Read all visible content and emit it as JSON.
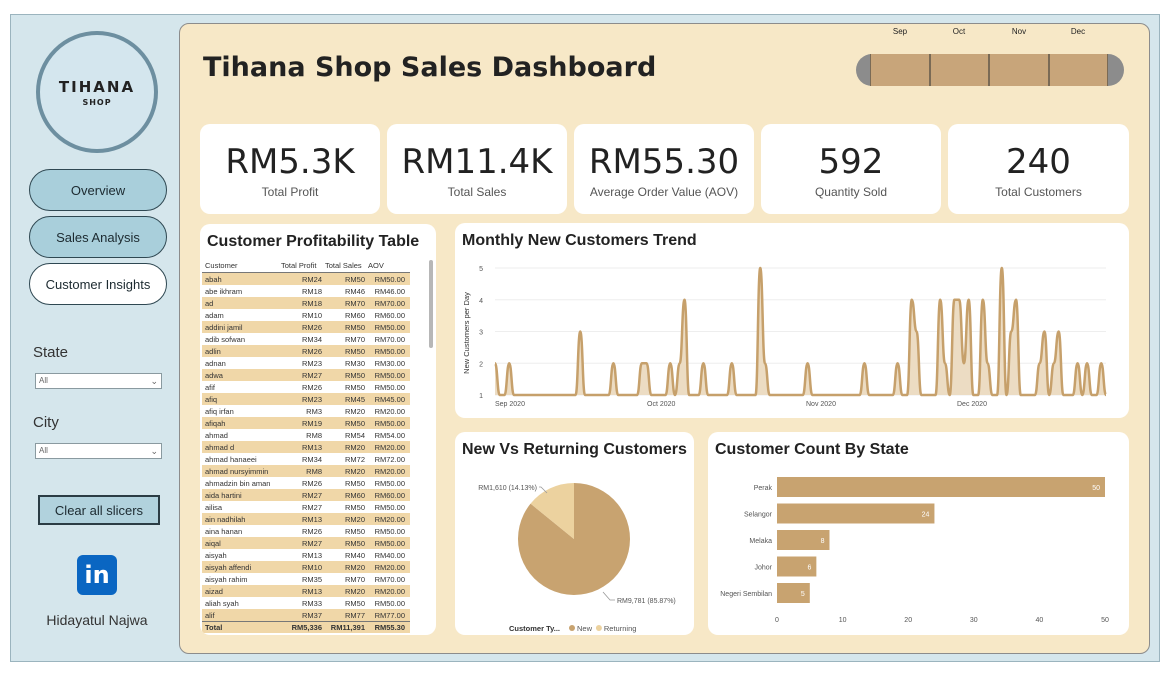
{
  "brand": {
    "name_line1": "TIHANA",
    "name_line2": "SHOP"
  },
  "nav": [
    {
      "label": "Overview"
    },
    {
      "label": "Sales Analysis"
    },
    {
      "label": "Customer Insights"
    }
  ],
  "filters": {
    "state": {
      "title": "State",
      "value": "All"
    },
    "city": {
      "title": "City",
      "value": "All"
    },
    "clear_label": "Clear all slicers"
  },
  "author": "Hidayatul Najwa",
  "linkedin_glyph": "in",
  "dashboard_title": "Tihana Shop Sales Dashboard",
  "timeline_months": [
    "Sep",
    "Oct",
    "Nov",
    "Dec"
  ],
  "kpis": [
    {
      "value": "RM5.3K",
      "label": "Total Profit"
    },
    {
      "value": "RM11.4K",
      "label": "Total Sales"
    },
    {
      "value": "RM55.30",
      "label": "Average Order Value (AOV)"
    },
    {
      "value": "592",
      "label": "Quantity Sold"
    },
    {
      "value": "240",
      "label": "Total Customers"
    }
  ],
  "table": {
    "title": "Customer Profitability Table",
    "columns": [
      "Customer",
      "Total Profit",
      "Total Sales",
      "AOV"
    ],
    "rows": [
      [
        "abah",
        "RM24",
        "RM50",
        "RM50.00"
      ],
      [
        "abe ikhram",
        "RM18",
        "RM46",
        "RM46.00"
      ],
      [
        "ad",
        "RM18",
        "RM70",
        "RM70.00"
      ],
      [
        "adam",
        "RM10",
        "RM60",
        "RM60.00"
      ],
      [
        "addini jamil",
        "RM26",
        "RM50",
        "RM50.00"
      ],
      [
        "adib sofwan",
        "RM34",
        "RM70",
        "RM70.00"
      ],
      [
        "adlin",
        "RM26",
        "RM50",
        "RM50.00"
      ],
      [
        "adnan",
        "RM23",
        "RM30",
        "RM30.00"
      ],
      [
        "adwa",
        "RM27",
        "RM50",
        "RM50.00"
      ],
      [
        "afif",
        "RM26",
        "RM50",
        "RM50.00"
      ],
      [
        "afiq",
        "RM23",
        "RM45",
        "RM45.00"
      ],
      [
        "afiq irfan",
        "RM3",
        "RM20",
        "RM20.00"
      ],
      [
        "afiqah",
        "RM19",
        "RM50",
        "RM50.00"
      ],
      [
        "ahmad",
        "RM8",
        "RM54",
        "RM54.00"
      ],
      [
        "ahmad d",
        "RM13",
        "RM20",
        "RM20.00"
      ],
      [
        "ahmad hanaeei",
        "RM34",
        "RM72",
        "RM72.00"
      ],
      [
        "ahmad nursyimmin",
        "RM8",
        "RM20",
        "RM20.00"
      ],
      [
        "ahmadzin bin aman",
        "RM26",
        "RM50",
        "RM50.00"
      ],
      [
        "aida hartini",
        "RM27",
        "RM60",
        "RM60.00"
      ],
      [
        "ailisa",
        "RM27",
        "RM50",
        "RM50.00"
      ],
      [
        "ain nadhilah",
        "RM13",
        "RM20",
        "RM20.00"
      ],
      [
        "aina hanan",
        "RM26",
        "RM50",
        "RM50.00"
      ],
      [
        "aiqal",
        "RM27",
        "RM50",
        "RM50.00"
      ],
      [
        "aisyah",
        "RM13",
        "RM40",
        "RM40.00"
      ],
      [
        "aisyah affendi",
        "RM10",
        "RM20",
        "RM20.00"
      ],
      [
        "aisyah rahim",
        "RM35",
        "RM70",
        "RM70.00"
      ],
      [
        "aizad",
        "RM13",
        "RM20",
        "RM20.00"
      ],
      [
        "aliah syah",
        "RM33",
        "RM50",
        "RM50.00"
      ],
      [
        "alif",
        "RM37",
        "RM77",
        "RM77.00"
      ]
    ],
    "total": [
      "Total",
      "RM5,336",
      "RM11,391",
      "RM55.30"
    ]
  },
  "chart_data": [
    {
      "type": "area",
      "title": "Monthly New Customers Trend",
      "ylabel": "New Customers per Day",
      "xlabel": "",
      "ylim": [
        1,
        5
      ],
      "yticks": [
        1,
        2,
        3,
        4,
        5
      ],
      "x_tick_labels": [
        "Sep 2020",
        "Oct 2020",
        "Nov 2020",
        "Dec 2020"
      ],
      "series": [
        {
          "values": [
            2,
            1,
            1,
            2,
            1,
            1,
            1,
            1,
            1,
            1,
            1,
            1,
            1,
            1,
            1,
            1,
            1,
            1,
            3,
            1,
            1,
            1,
            1,
            1,
            1,
            2,
            1,
            1,
            1,
            1,
            1,
            2,
            2,
            1,
            1,
            1,
            1,
            2,
            1,
            2,
            4,
            1,
            1,
            1,
            2,
            1,
            1,
            1,
            1,
            1,
            2,
            1,
            1,
            1,
            1,
            1,
            5,
            2,
            1,
            1,
            1,
            1,
            1,
            1,
            1,
            1,
            2,
            1,
            1,
            1,
            1,
            1,
            1,
            1,
            1,
            1,
            1,
            1,
            2,
            1,
            1,
            1,
            1,
            1,
            1,
            2,
            1,
            1,
            4,
            3,
            1,
            1,
            1,
            1,
            4,
            2,
            1,
            4,
            4,
            2,
            4,
            1,
            1,
            4,
            2,
            1,
            1,
            5,
            1,
            3,
            4,
            1,
            1,
            1,
            1,
            2,
            3,
            1,
            2,
            3,
            1,
            1,
            1,
            2,
            1,
            2,
            1,
            1,
            2,
            1
          ]
        }
      ]
    },
    {
      "type": "pie",
      "title": "New Vs Returning Customers",
      "legend_title": "Customer Ty...",
      "legend_position": "bottom",
      "slices": [
        {
          "name": "New",
          "value": 9781,
          "label": "RM9,781 (85.87%)",
          "color": "#c8a370"
        },
        {
          "name": "Returning",
          "value": 1610,
          "label": "RM1,610 (14.13%)",
          "color": "#ecd29f"
        }
      ]
    },
    {
      "type": "bar",
      "orientation": "horizontal",
      "title": "Customer Count By State",
      "categories": [
        "Perak",
        "Selangor",
        "Melaka",
        "Johor",
        "Negeri Sembilan"
      ],
      "values": [
        50,
        24,
        8,
        6,
        5
      ],
      "xlim": [
        0,
        50
      ],
      "xticks": [
        0,
        10,
        20,
        30,
        40,
        50
      ],
      "color": "#c8a370"
    }
  ],
  "colors": {
    "panel": "#f7e8c7",
    "sidebar": "#d5e6ec",
    "accent": "#c8a370",
    "button": "#a9cfdb"
  }
}
